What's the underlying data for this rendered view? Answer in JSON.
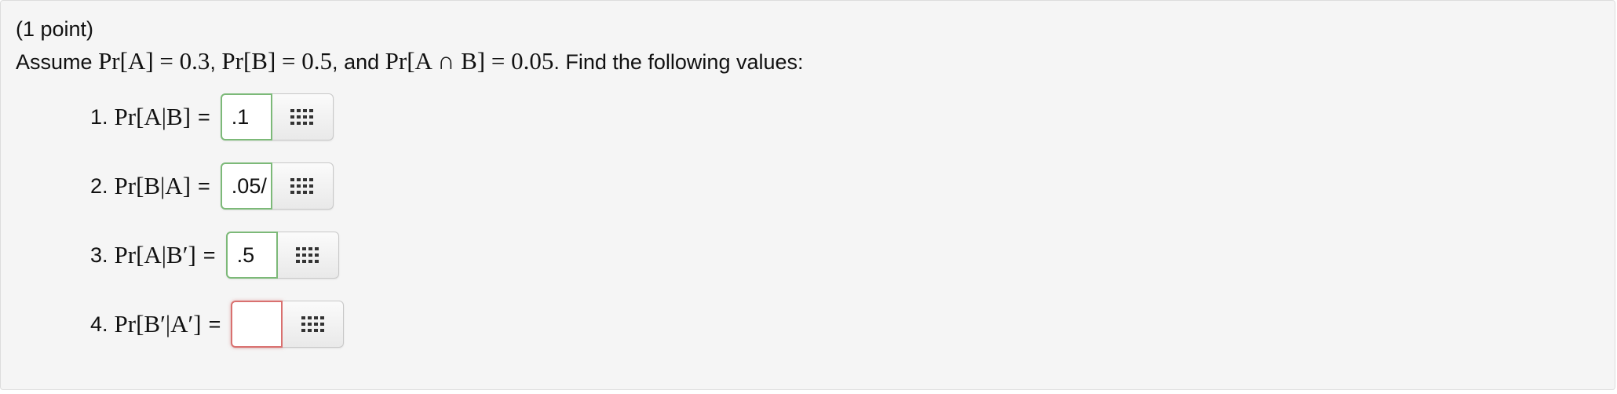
{
  "problem": {
    "points": "(1 point)",
    "assume_word": "Assume",
    "given": [
      "Pr[A] = 0.3",
      "Pr[B] = 0.5",
      "Pr[A ∩ B] = 0.05"
    ],
    "and_word": "and",
    "instruction": "Find the following values:"
  },
  "questions": [
    {
      "number": "1.",
      "expression": "Pr[A|B]",
      "equals": "=",
      "answer": ".1",
      "status": "correct",
      "keypad_icon": "keypad-grid-icon"
    },
    {
      "number": "2.",
      "expression": "Pr[B|A]",
      "equals": "=",
      "answer": ".05/",
      "status": "correct",
      "keypad_icon": "keypad-grid-icon"
    },
    {
      "number": "3.",
      "expression": "Pr[A|B′]",
      "equals": "=",
      "answer": ".5",
      "status": "correct",
      "keypad_icon": "keypad-grid-icon"
    },
    {
      "number": "4.",
      "expression": "Pr[B′|A′]",
      "equals": "=",
      "answer": "",
      "status": "incorrect",
      "keypad_icon": "keypad-grid-icon"
    }
  ],
  "colors": {
    "panel_background": "#f5f5f5",
    "correct_border": "#7cb978",
    "incorrect_border": "#d9706f",
    "keypad_icon": "#333333"
  }
}
